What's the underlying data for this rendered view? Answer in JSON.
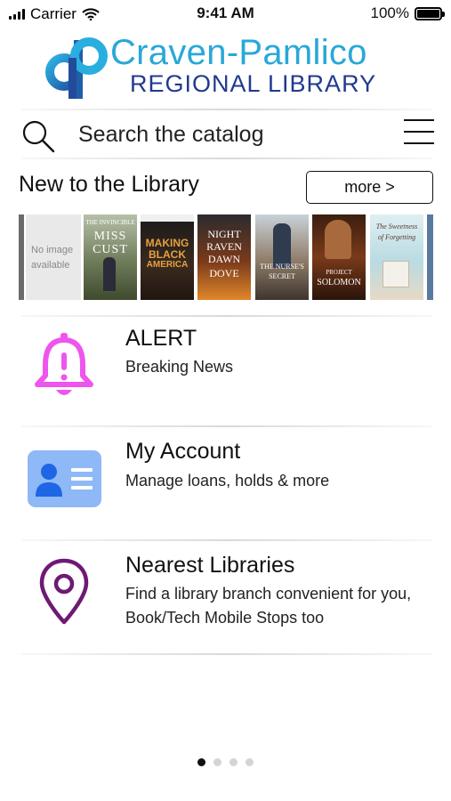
{
  "status_bar": {
    "carrier": "Carrier",
    "time": "9:41 AM",
    "battery": "100%"
  },
  "header": {
    "logo_line1": "Craven-Pamlico",
    "logo_line2": "REGIONAL LIBRARY"
  },
  "search": {
    "placeholder": "Search the catalog"
  },
  "new_items": {
    "title": "New to the Library",
    "more_label": "more >",
    "books": [
      {
        "label": "No image\navailable",
        "kind": "noimg"
      },
      {
        "label": "THE INVINCIBLE MISS CUST"
      },
      {
        "label": "MAKING BLACK AMERICA"
      },
      {
        "label": "NIGHT OF THE RAVEN, DAWN OF THE DOVE"
      },
      {
        "label": "THE NURSE'S SECRET"
      },
      {
        "label": "PROJECT SOLOMON"
      },
      {
        "label": "The Sweetness of Forgetting"
      }
    ]
  },
  "menu": [
    {
      "title": "ALERT",
      "subtitle": [
        "Breaking News"
      ],
      "icon": "bell-alert-icon",
      "color": "#ee55ee"
    },
    {
      "title": "My Account",
      "subtitle": [
        "Manage loans, holds & more"
      ],
      "icon": "account-card-icon",
      "color": "#4c8ff3"
    },
    {
      "title": "Nearest Libraries",
      "subtitle": [
        "Find a library branch convenient for you,",
        "Book/Tech Mobile Stops too"
      ],
      "icon": "map-pin-icon",
      "color": "#6e1a73"
    }
  ],
  "pager": {
    "count": 4,
    "active": 0
  }
}
